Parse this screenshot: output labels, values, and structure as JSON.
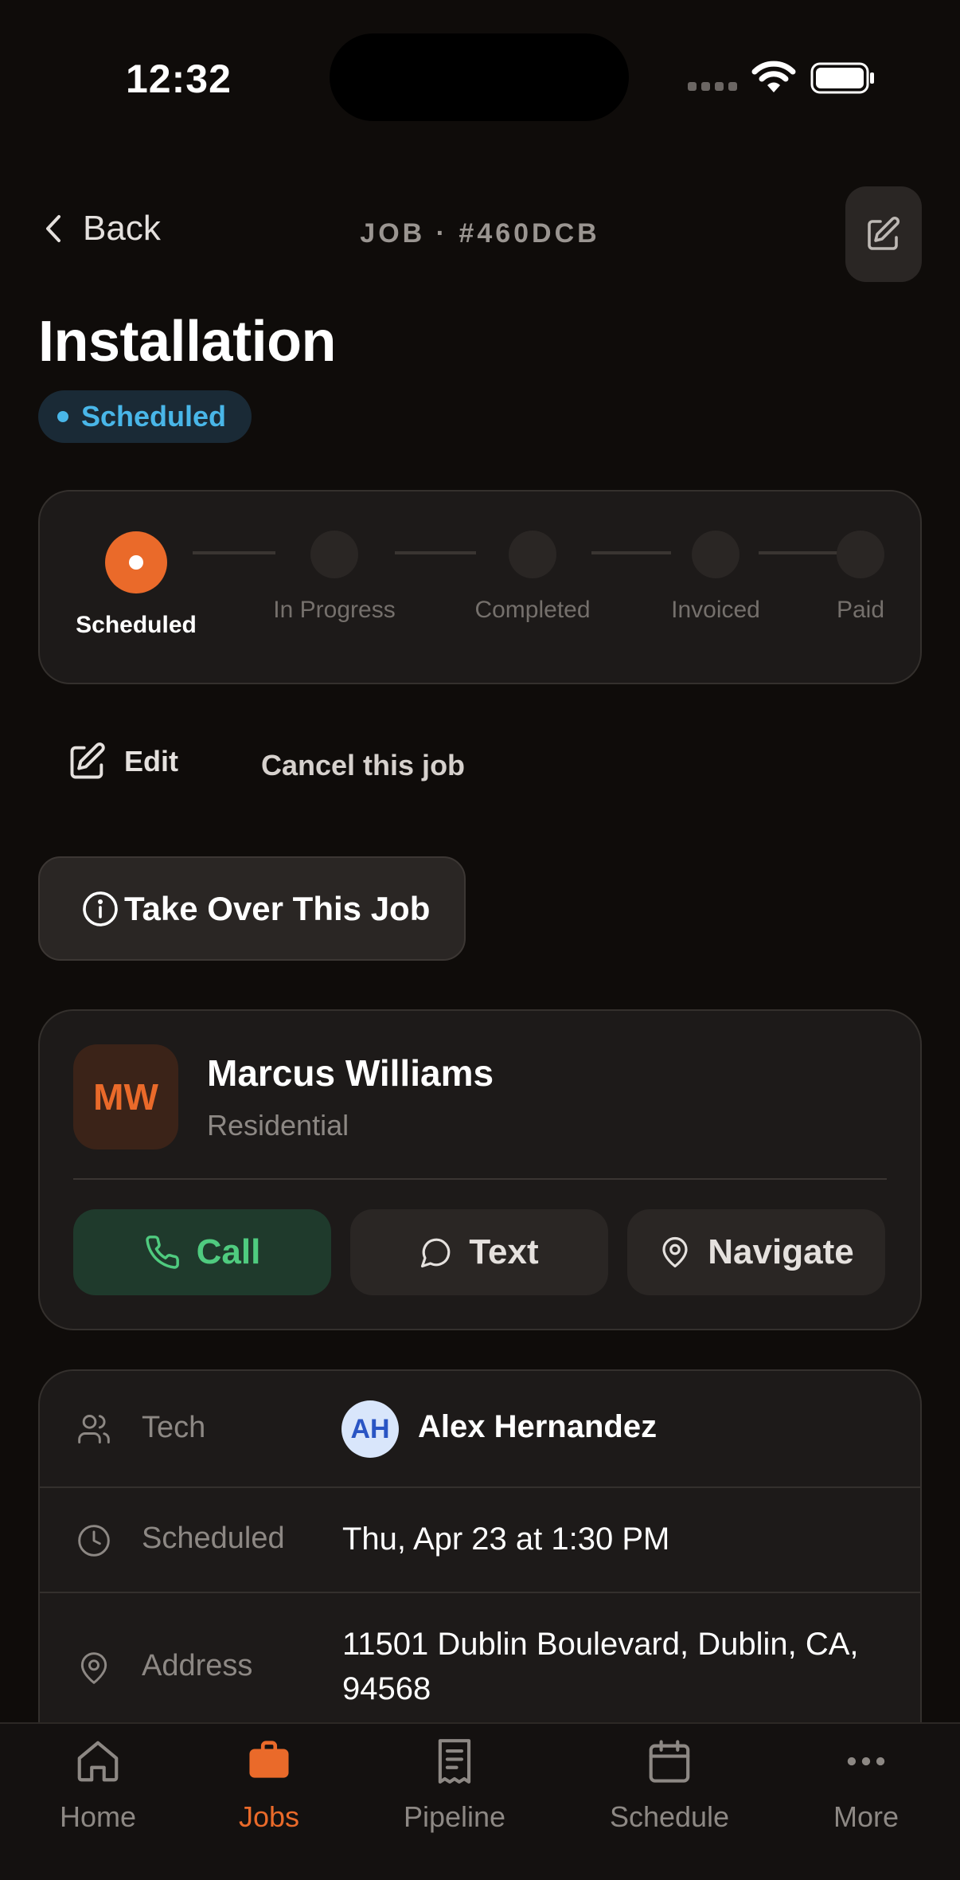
{
  "status_bar": {
    "time": "12:32"
  },
  "header": {
    "back_label": "Back",
    "job_id": "JOB · #460DCB"
  },
  "job": {
    "title": "Installation",
    "status": "Scheduled"
  },
  "progress": {
    "steps": [
      "Scheduled",
      "In Progress",
      "Completed",
      "Invoiced",
      "Paid"
    ],
    "current_index": 0
  },
  "actions": {
    "edit_label": "Edit",
    "cancel_label": "Cancel this job",
    "takeover_label": "Take Over This Job"
  },
  "customer": {
    "initials": "MW",
    "name": "Marcus Williams",
    "type": "Residential",
    "call_label": "Call",
    "text_label": "Text",
    "navigate_label": "Navigate"
  },
  "details": {
    "tech_label": "Tech",
    "tech_initials": "AH",
    "tech_name": "Alex Hernandez",
    "scheduled_label": "Scheduled",
    "scheduled_value": "Thu, Apr 23 at 1:30 PM",
    "address_label": "Address",
    "address_line1": "11501 Dublin Boulevard, Dublin, CA,",
    "address_line2": "94568"
  },
  "nav": {
    "items": [
      "Home",
      "Jobs",
      "Pipeline",
      "Schedule",
      "More"
    ],
    "active": "Jobs"
  },
  "colors": {
    "accent": "#ea6a2a",
    "status_blue": "#49b6e8",
    "call_green": "#4fcb7f",
    "background": "#0f0c0a"
  }
}
